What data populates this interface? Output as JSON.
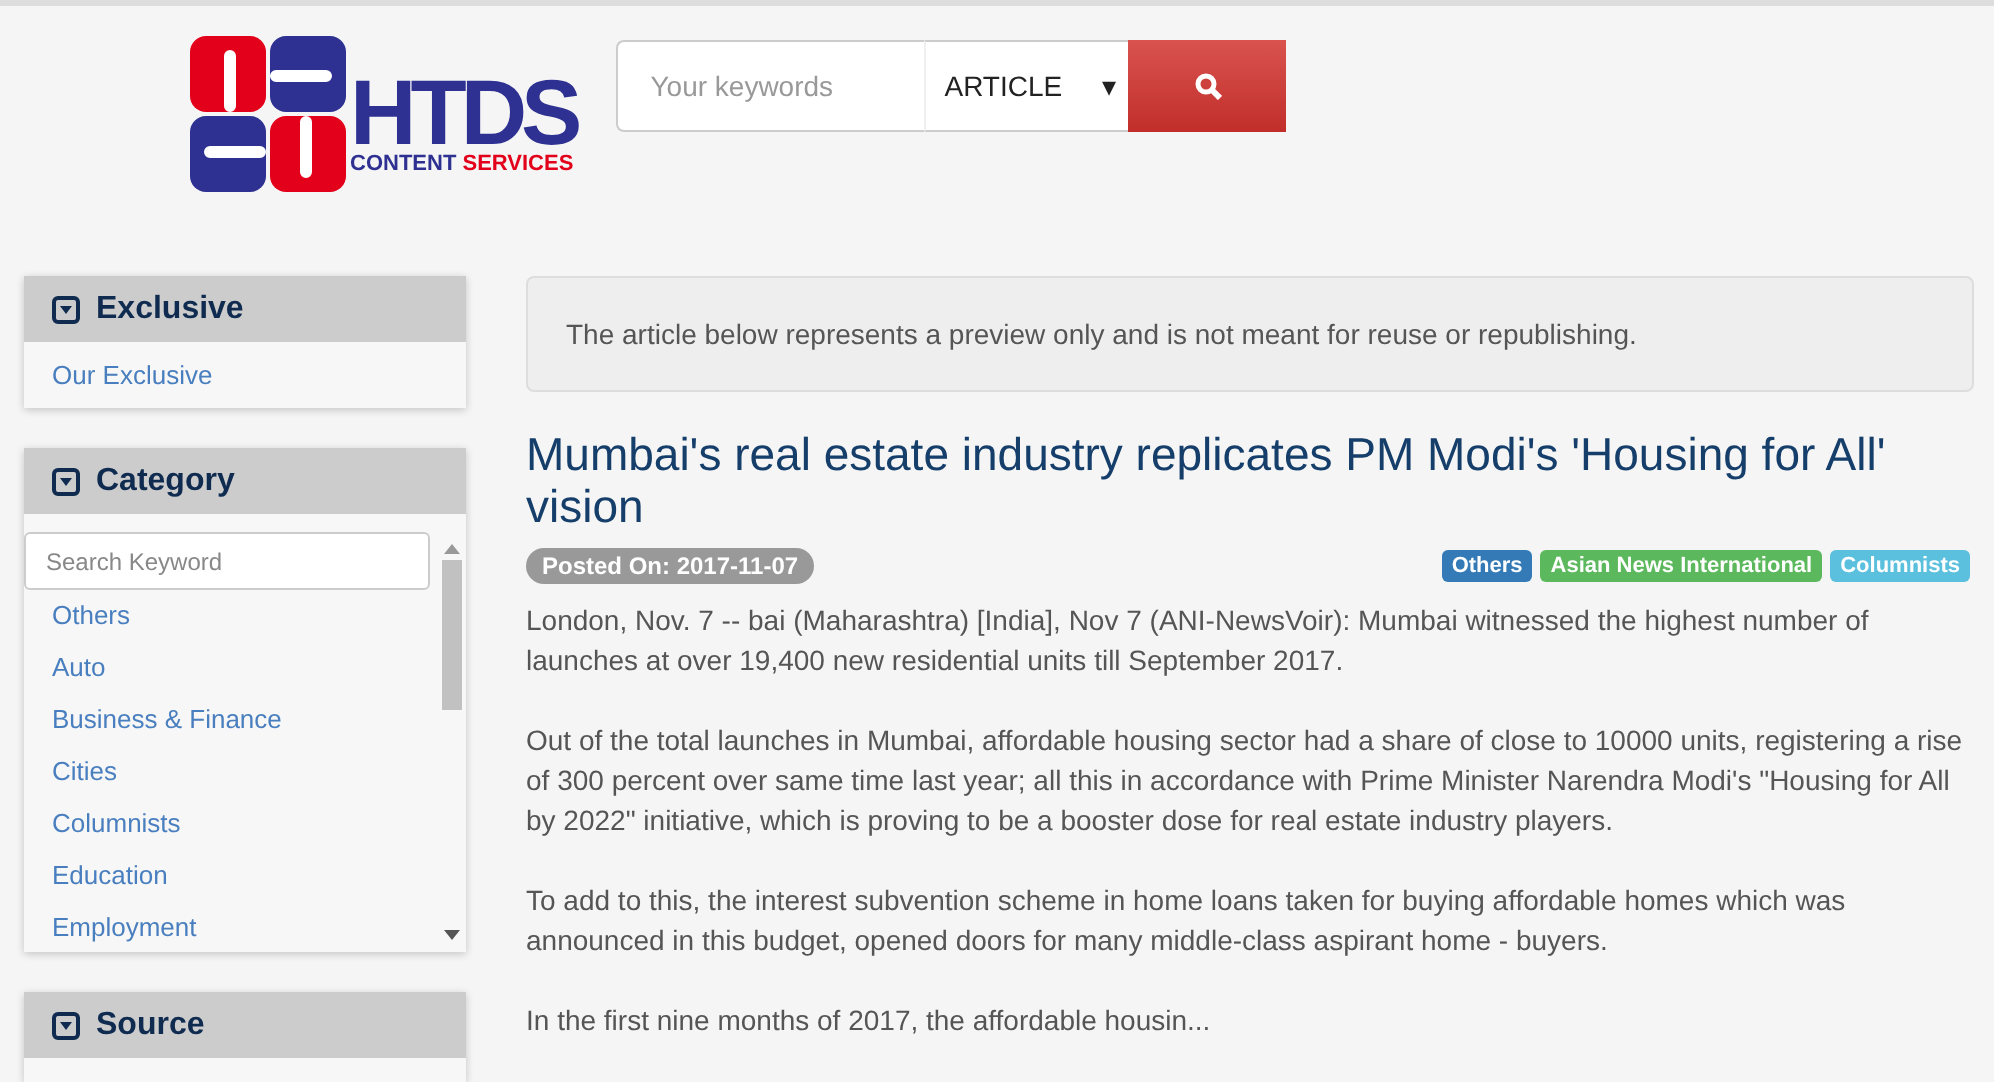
{
  "logo": {
    "mark": "HTDS",
    "line1": "CONTENT",
    "line2": "SERVICES"
  },
  "search": {
    "placeholder": "Your keywords",
    "type": "ARTICLE",
    "arrow": "▾"
  },
  "sidebar": [
    {
      "title": "Exclusive",
      "kind": "links",
      "items": [
        "Our Exclusive"
      ]
    },
    {
      "title": "Category",
      "kind": "filter",
      "placeholder": "Search Keyword",
      "items": [
        "Others",
        "Auto",
        "Business & Finance",
        "Cities",
        "Columnists",
        "Education",
        "Employment"
      ]
    },
    {
      "title": "Source",
      "kind": "cut"
    }
  ],
  "notice": "The article below represents a preview only and is not meant for reuse or republishing.",
  "article": {
    "title": "Mumbai's real estate industry replicates PM Modi's 'Housing for All' vision",
    "posted": "Posted On: 2017-11-07",
    "tags": [
      {
        "label": "Others",
        "color": "#337ab7"
      },
      {
        "label": "Asian News International",
        "color": "#5cb85c"
      },
      {
        "label": "Columnists",
        "color": "#5bc0de"
      }
    ],
    "paragraphs": [
      "London, Nov. 7 -- bai (Maharashtra) [India], Nov 7 (ANI-NewsVoir): Mumbai witnessed the highest number of launches at over 19,400 new residential units till September 2017.",
      "Out of the total launches in Mumbai, affordable housing sector had a share of close to 10000 units, registering a rise of 300 percent over same time last year; all this in accordance with Prime Minister Narendra Modi's \"Housing for All by 2022\" initiative, which is proving to be a booster dose for real estate industry players.",
      "To add to this, the interest subvention scheme in home loans taken for buying affordable homes which was announced in this budget, opened doors for many middle-class aspirant home - buyers.",
      "In the first nine months of 2017, the affordable housin..."
    ]
  }
}
